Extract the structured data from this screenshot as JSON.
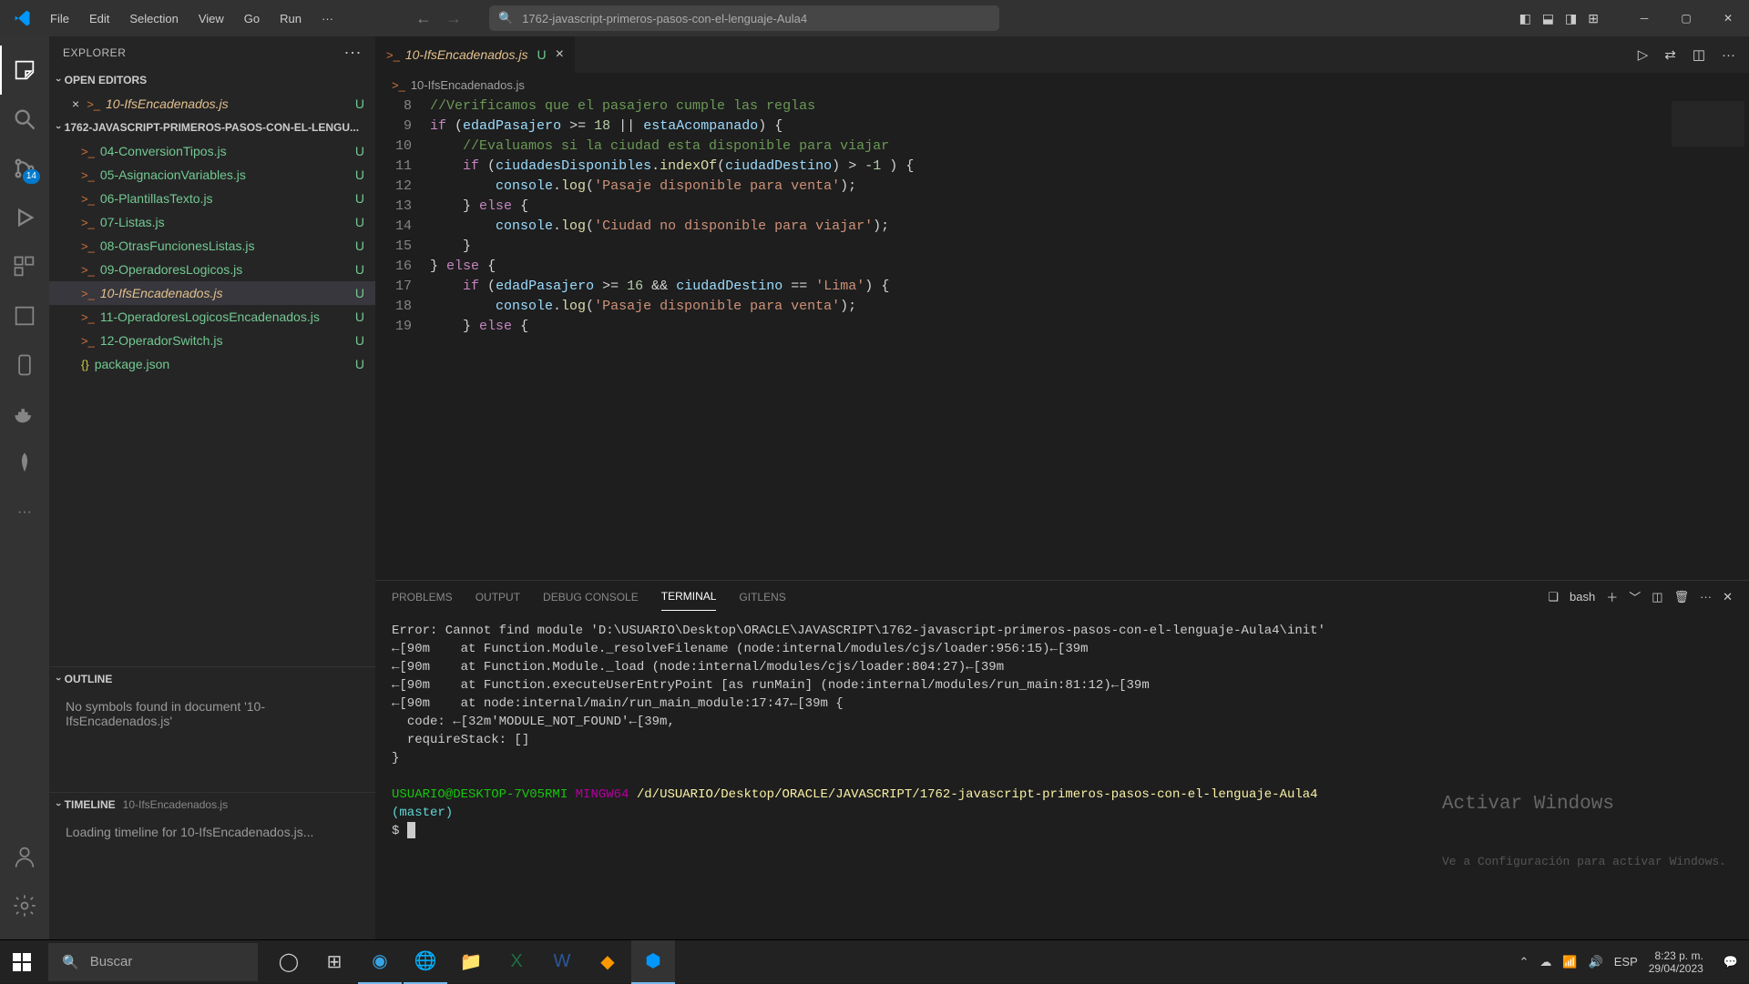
{
  "titlebar": {
    "menu": [
      "File",
      "Edit",
      "Selection",
      "View",
      "Go",
      "Run"
    ],
    "search_text": "1762-javascript-primeros-pasos-con-el-lenguaje-Aula4"
  },
  "activitybar": {
    "scm_badge": "14"
  },
  "sidebar": {
    "title": "EXPLORER",
    "open_editors_label": "OPEN EDITORS",
    "open_editor_file": "10-IfsEncadenados.js",
    "project_label": "1762-JAVASCRIPT-PRIMEROS-PASOS-CON-EL-LENGU...",
    "files": [
      {
        "name": "04-ConversionTipos.js",
        "status": "U"
      },
      {
        "name": "05-AsignacionVariables.js",
        "status": "U"
      },
      {
        "name": "06-PlantillasTexto.js",
        "status": "U"
      },
      {
        "name": "07-Listas.js",
        "status": "U"
      },
      {
        "name": "08-OtrasFuncionesListas.js",
        "status": "U"
      },
      {
        "name": "09-OperadoresLogicos.js",
        "status": "U"
      },
      {
        "name": "10-IfsEncadenados.js",
        "status": "U"
      },
      {
        "name": "11-OperadoresLogicosEncadenados.js",
        "status": "U"
      },
      {
        "name": "12-OperadorSwitch.js",
        "status": "U"
      },
      {
        "name": "package.json",
        "status": "U"
      }
    ],
    "outline_label": "OUTLINE",
    "outline_msg": "No symbols found in document '10-IfsEncadenados.js'",
    "timeline_label": "TIMELINE",
    "timeline_file": "10-IfsEncadenados.js",
    "timeline_msg": "Loading timeline for 10-IfsEncadenados.js..."
  },
  "editor": {
    "tab_name": "10-IfsEncadenados.js",
    "tab_status": "U",
    "breadcrumb": "10-IfsEncadenados.js",
    "line_numbers": [
      8,
      9,
      10,
      11,
      12,
      13,
      14,
      15,
      16,
      17,
      18,
      19
    ]
  },
  "panel": {
    "tabs": [
      "PROBLEMS",
      "OUTPUT",
      "DEBUG CONSOLE",
      "TERMINAL",
      "GITLENS"
    ],
    "shell": "bash",
    "terminal": {
      "error_line": "Error: Cannot find module 'D:\\USUARIO\\Desktop\\ORACLE\\JAVASCRIPT\\1762-javascript-primeros-pasos-con-el-lenguaje-Aula4\\init'",
      "stack1": "←[90m    at Function.Module._resolveFilename (node:internal/modules/cjs/loader:956:15)←[39m",
      "stack2": "←[90m    at Function.Module._load (node:internal/modules/cjs/loader:804:27)←[39m",
      "stack3": "←[90m    at Function.executeUserEntryPoint [as runMain] (node:internal/modules/run_main:81:12)←[39m",
      "stack4": "←[90m    at node:internal/main/run_main_module:17:47←[39m {",
      "code_line": "  code: ←[32m'MODULE_NOT_FOUND'←[39m,",
      "require_line": "  requireStack: []",
      "brace": "}",
      "prompt_user": "USUARIO@DESKTOP-7V05RMI",
      "prompt_mingw": "MINGW64",
      "prompt_path": "/d/USUARIO/Desktop/ORACLE/JAVASCRIPT/1762-javascript-primeros-pasos-con-el-lenguaje-Aula4",
      "prompt_branch": "(master)",
      "prompt_symbol": "$"
    }
  },
  "watermark": {
    "title": "Activar Windows",
    "sub": "Ve a Configuración para activar Windows."
  },
  "taskbar": {
    "search_placeholder": "Buscar",
    "lang": "ESP",
    "time": "8:23 p. m.",
    "date": "29/04/2023"
  }
}
